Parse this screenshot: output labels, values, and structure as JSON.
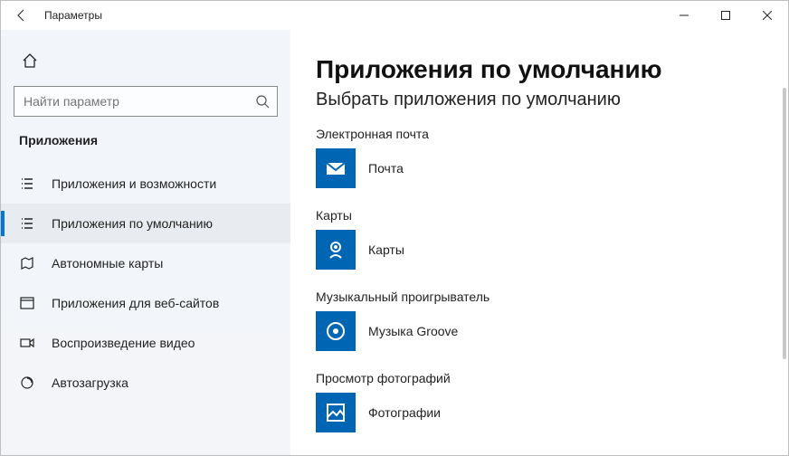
{
  "window": {
    "title": "Параметры"
  },
  "search": {
    "placeholder": "Найти параметр"
  },
  "section": {
    "title": "Приложения"
  },
  "nav": [
    {
      "label": "Приложения и возможности"
    },
    {
      "label": "Приложения по умолчанию"
    },
    {
      "label": "Автономные карты"
    },
    {
      "label": "Приложения для веб-сайтов"
    },
    {
      "label": "Воспроизведение видео"
    },
    {
      "label": "Автозагрузка"
    }
  ],
  "page": {
    "title": "Приложения по умолчанию",
    "subtitle": "Выбрать приложения по умолчанию"
  },
  "defaults": {
    "email": {
      "label": "Электронная почта",
      "app": "Почта"
    },
    "maps": {
      "label": "Карты",
      "app": "Карты"
    },
    "music": {
      "label": "Музыкальный проигрыватель",
      "app": "Музыка Groove"
    },
    "photos": {
      "label": "Просмотр фотографий",
      "app": "Фотографии"
    }
  },
  "colors": {
    "accent": "#0078d7",
    "tile": "#0066b4"
  }
}
